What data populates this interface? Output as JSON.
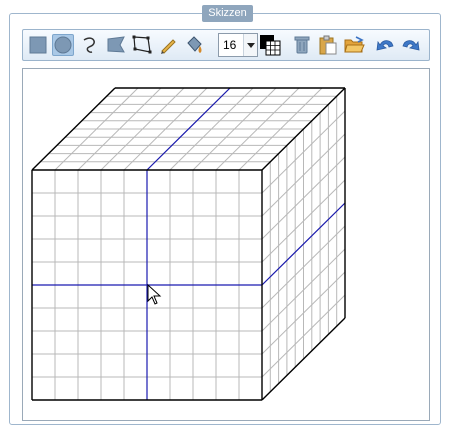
{
  "panel": {
    "title": "Skizzen"
  },
  "toolbar": {
    "tools": [
      {
        "name": "rectangle-tool",
        "icon": "square-icon"
      },
      {
        "name": "ellipse-tool",
        "icon": "circle-icon",
        "active": true
      },
      {
        "name": "curve-tool",
        "icon": "curve-icon"
      },
      {
        "name": "polygon-tool",
        "icon": "polygon-icon"
      },
      {
        "name": "freeform-tool",
        "icon": "freeform-icon"
      },
      {
        "name": "pen-tool",
        "icon": "pencil-icon"
      },
      {
        "name": "fill-tool",
        "icon": "paint-bucket-icon"
      }
    ],
    "size_value": "16",
    "actions": [
      "grid-color-icon",
      "trash-icon",
      "clipboard-icon",
      "open-folder-icon",
      "undo-icon",
      "redo-icon"
    ]
  },
  "colors": {
    "grid": "#b8b8b8",
    "outline": "#000000",
    "axis": "#1a1ab0",
    "accent": "#8fa6bd"
  }
}
